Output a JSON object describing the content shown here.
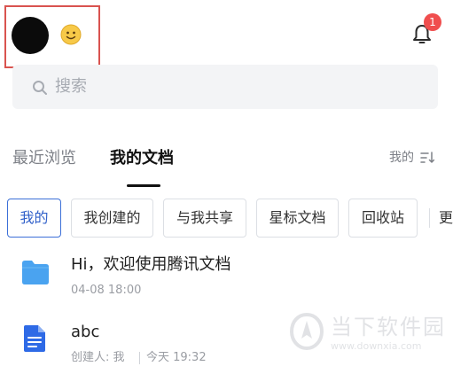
{
  "header": {
    "emoji": "🙂",
    "notification_count": "1"
  },
  "search": {
    "placeholder": "搜索"
  },
  "tabs": [
    {
      "label": "最近浏览",
      "active": false
    },
    {
      "label": "我的文档",
      "active": true
    }
  ],
  "sort": {
    "label": "我的"
  },
  "filters": [
    {
      "label": "我的",
      "active": true
    },
    {
      "label": "我创建的",
      "active": false
    },
    {
      "label": "与我共享",
      "active": false
    },
    {
      "label": "星标文档",
      "active": false
    },
    {
      "label": "回收站",
      "active": false
    }
  ],
  "filters_more": "更",
  "files": [
    {
      "icon": "folder-icon",
      "name": "Hi，欢迎使用腾讯文档",
      "meta": "04-08 18:00"
    },
    {
      "icon": "doc-icon",
      "name": "abc",
      "creator": "创建人: 我",
      "time": "今天 19:32"
    }
  ],
  "watermark": {
    "text": "当下软件园",
    "url": "www.downxia.com"
  },
  "colors": {
    "accent": "#3b6fd8",
    "badge": "#f04e4e",
    "highlight": "#d9534f",
    "folder": "#4aa3f0",
    "doc": "#2e6ae6"
  }
}
